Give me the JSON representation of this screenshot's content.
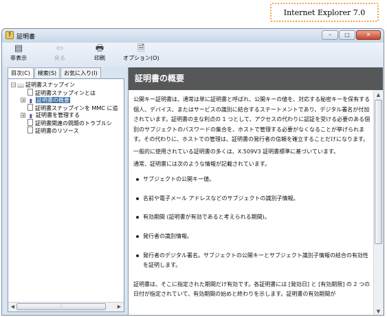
{
  "badge": "Internet Explorer 7.0",
  "window": {
    "title": "証明書",
    "buttons": [
      "–",
      "□",
      "✕"
    ]
  },
  "toolbar": {
    "hide_label": "非表示",
    "back_label": "戻る",
    "print_label": "印刷",
    "options_label": "オプション(O)"
  },
  "tabs": [
    "目次(C)",
    "検索(S)",
    "お気に入り(I)"
  ],
  "tree": {
    "root": "証明書スナップイン",
    "items": [
      "証明書スナップインとは",
      "証明書の概要",
      "証明書スナップインを MMC に追",
      "証明書を管理する",
      "証明書関連の問題のトラブルシ",
      "証明書のリソース"
    ]
  },
  "content": {
    "heading": "証明書の概要",
    "para1": "公開キー証明書は、通常は単に証明書と呼ばれ、公開キーの値を、対応する秘密キーを保有する個人、デバイス、またはサービスの識別に結合するステートメントであり、デジタル署名が付加されています。証明書の主な利点の 1 つとして、アクセスの代わりに認証を受ける必要のある個別のサブジェクトのパスワードの集合を、ホストで管理する必要がなくなることが挙げられます。その代わりに、ホストでの管理は、証明書の発行者の信頼を確立することだけになります。",
    "para2": "一般的に使用されている証明書の多くは、X.509V3 証明書標準に基づいています。",
    "para3": "通常、証明書には次のような情報が記載されています。",
    "bullets": [
      "サブジェクトの公開キー値。",
      "名前や電子メール アドレスなどのサブジェクトの識別子情報。",
      "有効期間 (証明書が有効であると考えられる期間)。",
      "発行者の識別情報。",
      "発行者のデジタル署名。サブジェクトの公開キーとサブジェクト識別子情報の結合の有効性を証明します。"
    ],
    "para4": "証明書は、そこに指定された期間だけ有効です。各証明書には [発効日] と [有効期限] の 2 つの日付が指定されていて、有効期間の始めと終わりを示します。証明書の有効期間が"
  }
}
